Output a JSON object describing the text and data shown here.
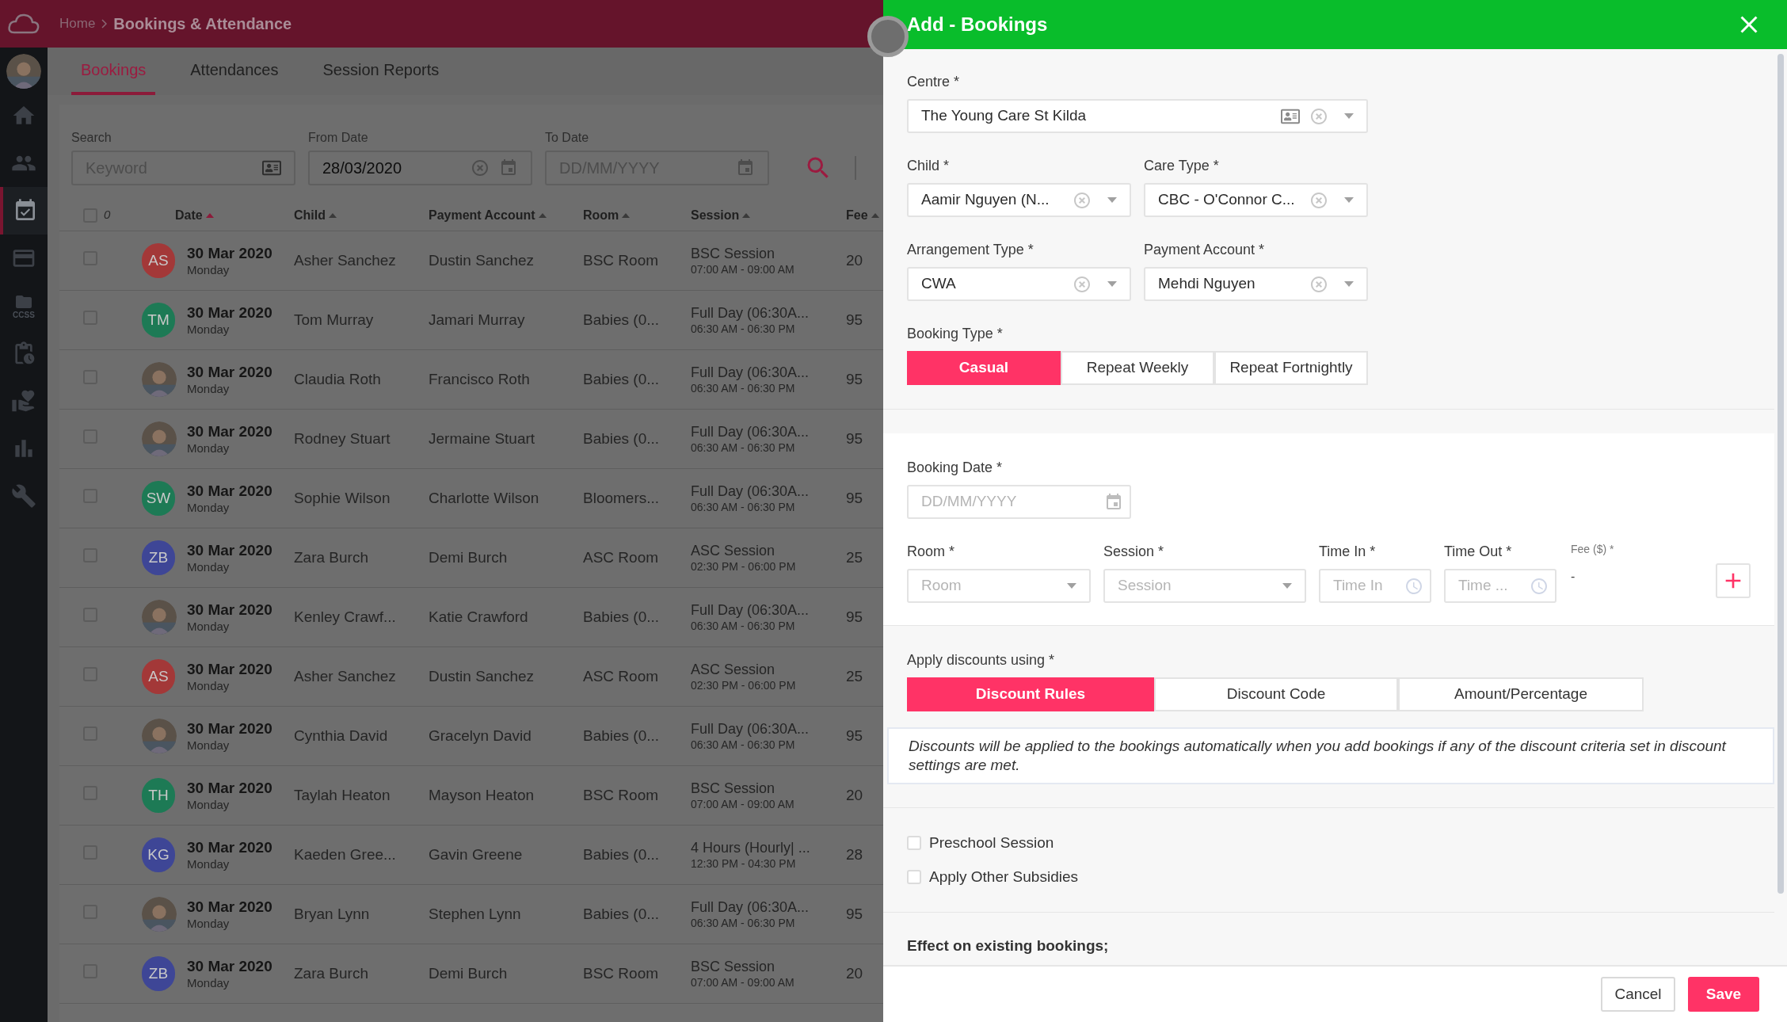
{
  "header": {
    "breadcrumb": [
      "Home",
      "Bookings & Attendance"
    ]
  },
  "sidebar": {
    "items": [
      {
        "selected": false
      },
      {
        "selected": false
      },
      {
        "selected": true
      },
      {
        "selected": false
      },
      {
        "selected": false,
        "label": "CCSS"
      },
      {
        "selected": false
      },
      {
        "selected": false
      },
      {
        "selected": false
      },
      {
        "selected": false
      }
    ]
  },
  "tabs": [
    {
      "label": "Bookings",
      "selected": true
    },
    {
      "label": "Attendances",
      "selected": false
    },
    {
      "label": "Session Reports",
      "selected": false
    }
  ],
  "filters": {
    "search": {
      "label": "Search",
      "placeholder": "Keyword"
    },
    "from_date": {
      "label": "From Date",
      "value": "28/03/2020"
    },
    "to_date": {
      "label": "To Date",
      "placeholder": "DD/MM/YYYY"
    }
  },
  "table": {
    "select_all": {
      "checked": false,
      "count": "0"
    },
    "columns": [
      {
        "label": "Date",
        "sorted": true
      },
      {
        "label": "Child",
        "sorted": false
      },
      {
        "label": "Payment Account",
        "sorted": false
      },
      {
        "label": "Room",
        "sorted": false
      },
      {
        "label": "Session",
        "sorted": false
      },
      {
        "label": "Fee",
        "sorted": false
      }
    ],
    "rows": [
      {
        "checked": false,
        "avatar": {
          "kind": "initials",
          "initials": "AS",
          "color": "#a33838"
        },
        "date": "30 Mar 2020",
        "day": "Monday",
        "child": "Asher Sanchez",
        "payment_account": "Dustin Sanchez",
        "room": "BSC Room",
        "session": "BSC Session",
        "time": "07:00 AM - 09:00 AM",
        "fee": "20"
      },
      {
        "checked": false,
        "avatar": {
          "kind": "initials",
          "initials": "TM",
          "color": "#1d7a55"
        },
        "date": "30 Mar 2020",
        "day": "Monday",
        "child": "Tom Murray",
        "payment_account": "Jamari Murray",
        "room": "Babies (0...",
        "session": "Full Day (06:30A...",
        "time": "06:30 AM - 06:30 PM",
        "fee": "95"
      },
      {
        "checked": false,
        "date": "30 Mar 2020",
        "day": "Monday",
        "child": "Claudia Roth",
        "payment_account": "Francisco Roth",
        "room": "Babies (0...",
        "session": "Full Day (06:30A...",
        "time": "06:30 AM - 06:30 PM",
        "fee": "95"
      },
      {
        "checked": false,
        "date": "30 Mar 2020",
        "day": "Monday",
        "child": "Rodney Stuart",
        "payment_account": "Jermaine Stuart",
        "room": "Babies (0...",
        "session": "Full Day (06:30A...",
        "time": "06:30 AM - 06:30 PM",
        "fee": "95"
      },
      {
        "checked": false,
        "avatar": {
          "kind": "initials",
          "initials": "SW",
          "color": "#1d7a55"
        },
        "date": "30 Mar 2020",
        "day": "Monday",
        "child": "Sophie Wilson",
        "payment_account": "Charlotte Wilson",
        "room": "Bloomers...",
        "session": "Full Day (06:30A...",
        "time": "06:30 AM - 06:30 PM",
        "fee": "95"
      },
      {
        "checked": false,
        "avatar": {
          "kind": "initials",
          "initials": "ZB",
          "color": "#3e4696"
        },
        "date": "30 Mar 2020",
        "day": "Monday",
        "child": "Zara Burch",
        "payment_account": "Demi Burch",
        "room": "ASC Room",
        "session": "ASC Session",
        "time": "02:30 PM - 06:00 PM",
        "fee": "25"
      },
      {
        "checked": false,
        "date": "30 Mar 2020",
        "day": "Monday",
        "child": "Kenley Crawf...",
        "payment_account": "Katie Crawford",
        "room": "Babies (0...",
        "session": "Full Day (06:30A...",
        "time": "06:30 AM - 06:30 PM",
        "fee": "95"
      },
      {
        "checked": false,
        "avatar": {
          "kind": "initials",
          "initials": "AS",
          "color": "#a33838"
        },
        "date": "30 Mar 2020",
        "day": "Monday",
        "child": "Asher Sanchez",
        "payment_account": "Dustin Sanchez",
        "room": "ASC Room",
        "session": "ASC Session",
        "time": "02:30 PM - 06:00 PM",
        "fee": "25"
      },
      {
        "checked": false,
        "date": "30 Mar 2020",
        "day": "Monday",
        "child": "Cynthia David",
        "payment_account": "Gracelyn David",
        "room": "Babies (0...",
        "session": "Full Day (06:30A...",
        "time": "06:30 AM - 06:30 PM",
        "fee": "95"
      },
      {
        "checked": false,
        "avatar": {
          "kind": "initials",
          "initials": "TH",
          "color": "#1d7a55"
        },
        "date": "30 Mar 2020",
        "day": "Monday",
        "child": "Taylah Heaton",
        "payment_account": "Mayson Heaton",
        "room": "BSC Room",
        "session": "BSC Session",
        "time": "07:00 AM - 09:00 AM",
        "fee": "20"
      },
      {
        "checked": false,
        "avatar": {
          "kind": "initials",
          "initials": "KG",
          "color": "#3e4696"
        },
        "date": "30 Mar 2020",
        "day": "Monday",
        "child": "Kaeden Gree...",
        "payment_account": "Gavin Greene",
        "room": "Babies (0...",
        "session": "4 Hours (Hourly| ...",
        "time": "12:30 PM - 04:30 PM",
        "fee": "28"
      },
      {
        "checked": false,
        "date": "30 Mar 2020",
        "day": "Monday",
        "child": "Bryan Lynn",
        "payment_account": "Stephen Lynn",
        "room": "Babies (0...",
        "session": "Full Day (06:30A...",
        "time": "06:30 AM - 06:30 PM",
        "fee": "95"
      },
      {
        "checked": false,
        "avatar": {
          "kind": "initials",
          "initials": "ZB",
          "color": "#3e4696"
        },
        "date": "30 Mar 2020",
        "day": "Monday",
        "child": "Zara Burch",
        "payment_account": "Demi Burch",
        "room": "BSC Room",
        "session": "BSC Session",
        "time": "07:00 AM - 09:00 AM",
        "fee": "20"
      }
    ]
  },
  "panel": {
    "title": "Add - Bookings",
    "centre": {
      "label": "Centre *",
      "value": "The Young Care St Kilda"
    },
    "child": {
      "label": "Child *",
      "value": "Aamir Nguyen (N..."
    },
    "care_type": {
      "label": "Care Type *",
      "value": "CBC - O'Connor C..."
    },
    "arrangement_type": {
      "label": "Arrangement Type *",
      "value": "CWA"
    },
    "payment_account": {
      "label": "Payment Account *",
      "value": "Mehdi Nguyen"
    },
    "booking_type": {
      "label": "Booking Type *",
      "options": [
        {
          "label": "Casual",
          "selected": true
        },
        {
          "label": "Repeat Weekly",
          "selected": false
        },
        {
          "label": "Repeat Fortnightly",
          "selected": false
        }
      ]
    },
    "booking_date": {
      "label": "Booking Date *",
      "placeholder": "DD/MM/YYYY"
    },
    "room": {
      "label": "Room *",
      "placeholder": "Room"
    },
    "session": {
      "label": "Session *",
      "placeholder": "Session"
    },
    "time_in": {
      "label": "Time In *",
      "placeholder": "Time In"
    },
    "time_out": {
      "label": "Time Out *",
      "placeholder": "Time ..."
    },
    "fee": {
      "label": "Fee ($) *",
      "value": "-"
    },
    "discounts": {
      "label": "Apply discounts using *",
      "options": [
        {
          "label": "Discount Rules",
          "selected": true
        },
        {
          "label": "Discount Code",
          "selected": false
        },
        {
          "label": "Amount/Percentage",
          "selected": false
        }
      ]
    },
    "discount_note": "Discounts will be applied to the bookings automatically when you add bookings if any of the discount criteria set in discount settings are met.",
    "checkboxes": [
      {
        "label": "Preschool Session",
        "checked": false
      },
      {
        "label": "Apply Other Subsidies",
        "checked": false
      }
    ],
    "effect_heading": "Effect on existing bookings;",
    "buttons": [
      {
        "label": "Cancel",
        "kind": "secondary"
      },
      {
        "label": "Save",
        "kind": "primary"
      }
    ]
  }
}
